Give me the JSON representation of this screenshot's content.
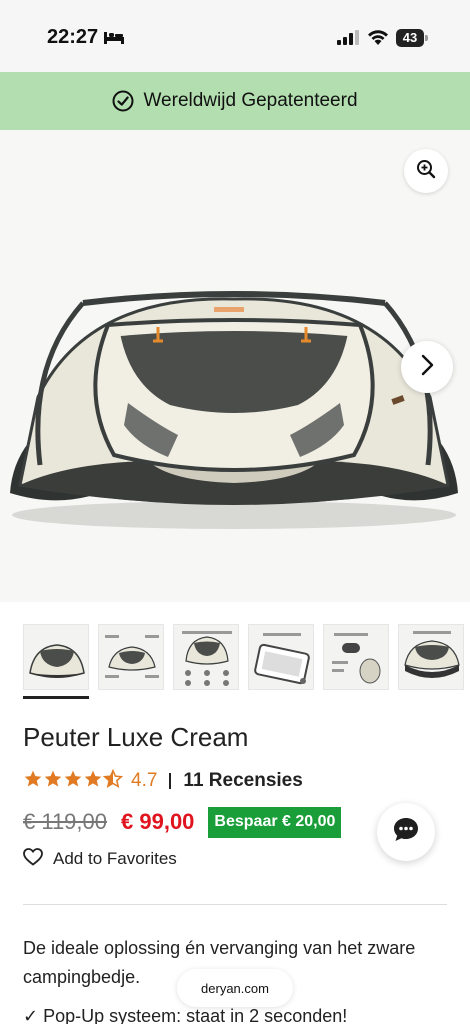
{
  "status_bar": {
    "time": "22:27",
    "battery": "43"
  },
  "banner": {
    "text": "Wereldwijd Gepatenteerd",
    "icon": "check-circle-icon",
    "bg_color": "#b3dfb0"
  },
  "gallery": {
    "zoom_icon": "zoom-in-icon",
    "next_icon": "chevron-right-icon",
    "thumbnail_count": 6,
    "active_thumbnail": 1
  },
  "product": {
    "title": "Peuter Luxe Cream",
    "rating_value": "4.7",
    "rating_stars": 4.5,
    "review_count": "11 Recensies",
    "price_old": "€ 119,00",
    "price_new": "€ 99,00",
    "save_label": "Bespaar  € 20,00",
    "favorites_label": "Add to Favorites",
    "description": "De ideale oplossing én vervanging van het zware campingbedje.",
    "bullet_1": "✓ Pop-Up systeem: staat in 2 seconden!"
  },
  "browser": {
    "url": "deryan.com"
  },
  "colors": {
    "accent_orange": "#e07b23",
    "price_red": "#e0141e",
    "save_green": "#1a9e3a"
  }
}
